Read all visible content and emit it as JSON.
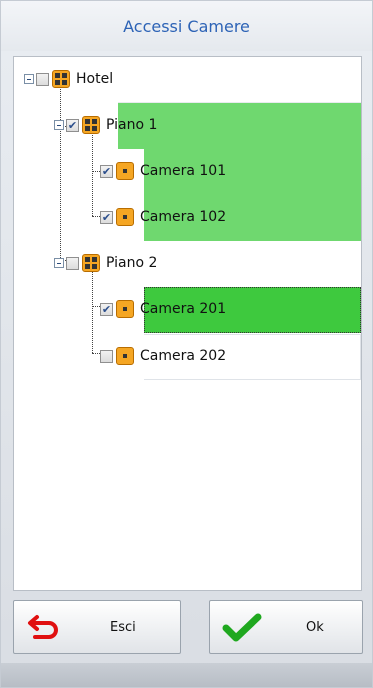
{
  "window": {
    "title": "Accessi Camere"
  },
  "tree": [
    {
      "label": "Hotel",
      "checked": false,
      "icon": "grid-icon"
    },
    {
      "label": "Piano 1",
      "checked": true,
      "icon": "grid-icon"
    },
    {
      "label": "Camera 101",
      "checked": true,
      "icon": "room-icon"
    },
    {
      "label": "Camera 102",
      "checked": true,
      "icon": "room-icon"
    },
    {
      "label": "Piano 2",
      "checked": false,
      "icon": "grid-icon"
    },
    {
      "label": "Camera 201",
      "checked": true,
      "icon": "room-icon"
    },
    {
      "label": "Camera 202",
      "checked": false,
      "icon": "room-icon"
    }
  ],
  "colors": {
    "checked_row": "#6fd86f",
    "focused_row": "#3ec93e",
    "title_text": "#2d63b6"
  },
  "buttons": {
    "exit": "Esci",
    "ok": "Ok"
  }
}
